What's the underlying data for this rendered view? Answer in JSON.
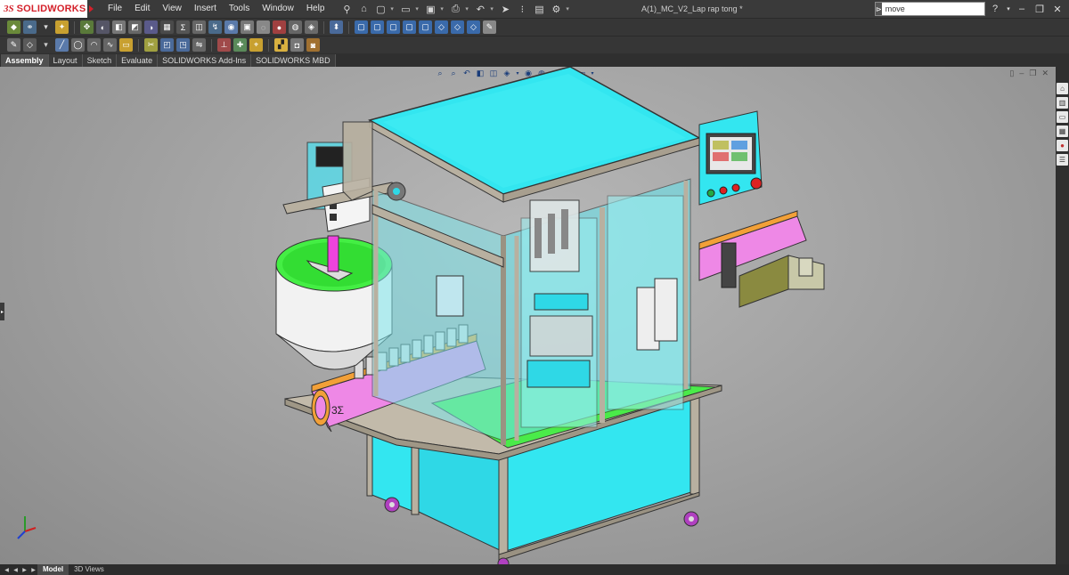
{
  "app": {
    "logo_mark": "3S",
    "logo_text": "SOLIDWORKS",
    "document_title": "A(1)_MC_V2_Lap rap tong *"
  },
  "menu": [
    "File",
    "Edit",
    "View",
    "Insert",
    "Tools",
    "Window",
    "Help"
  ],
  "search": {
    "value": "move",
    "prefix": "⊳"
  },
  "command_tabs": [
    {
      "label": "Assembly",
      "active": true
    },
    {
      "label": "Layout",
      "active": false
    },
    {
      "label": "Sketch",
      "active": false
    },
    {
      "label": "Evaluate",
      "active": false
    },
    {
      "label": "SOLIDWORKS Add-Ins",
      "active": false
    },
    {
      "label": "SOLIDWORKS MBD",
      "active": false
    }
  ],
  "bottom_tabs": [
    {
      "label": "Model",
      "active": true
    },
    {
      "label": "3D Views",
      "active": false
    }
  ],
  "triad": {
    "x": "x",
    "y": "y",
    "z": "z"
  },
  "hmi": {
    "screen_label": ""
  },
  "colors": {
    "accent_red": "#d4202a",
    "body_cyan": "#33e6f0",
    "frame_tan": "#b8b0a0",
    "conveyor_pink": "#ee88e6",
    "hopper_green": "#44ee44",
    "caster_purple": "#b040c0"
  }
}
